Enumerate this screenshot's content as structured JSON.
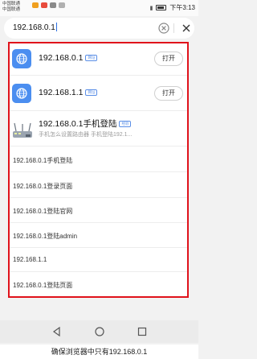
{
  "statusbar": {
    "carrier_1": "中国联通",
    "carrier_2": "中国联通",
    "time": "下午3:13"
  },
  "search": {
    "value": "192.168.0.1"
  },
  "results": [
    {
      "title": "192.168.0.1",
      "tag": "网址",
      "button": "打开"
    },
    {
      "title": "192.168.1.1",
      "tag": "网址",
      "button": "打开"
    },
    {
      "title": "192.168.0.1手机登陆",
      "tag": "经验",
      "subtitle": "手机怎么设置路由器 手机登陆192.1..."
    }
  ],
  "suggestions": [
    "192.168.0.1手机登陆",
    "192.168.0.1登录页面",
    "192.168.0.1登陆官网",
    "192.168.0.1登陆admin",
    "192.168.1.1",
    "192.168.0.1登陆页面"
  ],
  "caption": "确保浏览器中只有192.168.0.1",
  "colors": {
    "highlight_border": "#e0121b",
    "accent": "#4b8ef0"
  }
}
